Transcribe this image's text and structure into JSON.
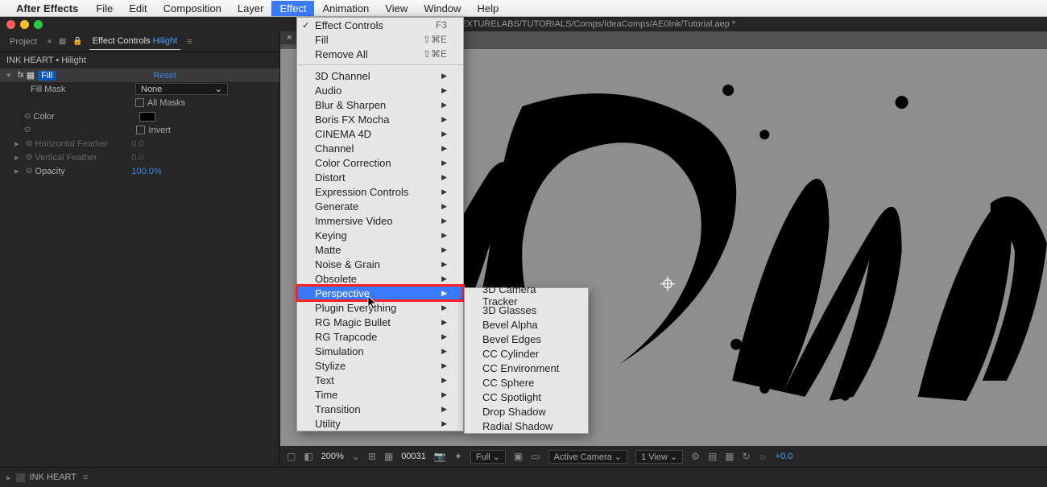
{
  "menubar": {
    "app": "After Effects",
    "items": [
      "File",
      "Edit",
      "Composition",
      "Layer",
      "Effect",
      "Animation",
      "View",
      "Window",
      "Help"
    ],
    "active": "Effect"
  },
  "titlebar": {
    "path": "sers/be/Documents/PROJECTS/TEXTURELABS/TUTORIALS/Comps/IdeaComps/AE0Ink/Tutorial.aep *"
  },
  "panel": {
    "tab_project": "Project",
    "tab_ec": "Effect Controls",
    "ec_layer": "Hilight",
    "breadcrumb": "INK HEART • Hilight"
  },
  "fx": {
    "name": "Fill",
    "reset": "Reset",
    "fill_mask_label": "Fill Mask",
    "fill_mask_value": "None",
    "all_masks": "All Masks",
    "color_label": "Color",
    "invert": "Invert",
    "h_feather_label": "Horizontal Feather",
    "h_feather_value": "0.0",
    "v_feather_label": "Vertical Feather",
    "v_feather_value": "0.0",
    "opacity_label": "Opacity",
    "opacity_value": "100.0%"
  },
  "effect_menu": {
    "top": [
      {
        "label": "Effect Controls",
        "shortcut": "F3",
        "check": true
      },
      {
        "label": "Fill",
        "shortcut": "⇧⌘E"
      },
      {
        "label": "Remove All",
        "shortcut": "⇧⌘E"
      }
    ],
    "categories": [
      "3D Channel",
      "Audio",
      "Blur & Sharpen",
      "Boris FX Mocha",
      "CINEMA 4D",
      "Channel",
      "Color Correction",
      "Distort",
      "Expression Controls",
      "Generate",
      "Immersive Video",
      "Keying",
      "Matte",
      "Noise & Grain",
      "Obsolete",
      "Perspective",
      "Plugin Everything",
      "RG Magic Bullet",
      "RG Trapcode",
      "Simulation",
      "Stylize",
      "Text",
      "Time",
      "Transition",
      "Utility"
    ],
    "highlight": "Perspective"
  },
  "submenu": {
    "items": [
      "3D Camera Tracker",
      "3D Glasses",
      "Bevel Alpha",
      "Bevel Edges",
      "CC Cylinder",
      "CC Environment",
      "CC Sphere",
      "CC Spotlight",
      "Drop Shadow",
      "Radial Shadow"
    ]
  },
  "viewer": {
    "zoom": "200%",
    "frame": "00031",
    "resolution": "Full",
    "camera": "Active Camera",
    "views": "1 View",
    "exposure": "+0.0"
  },
  "footer": {
    "comp_name": "INK HEART"
  }
}
